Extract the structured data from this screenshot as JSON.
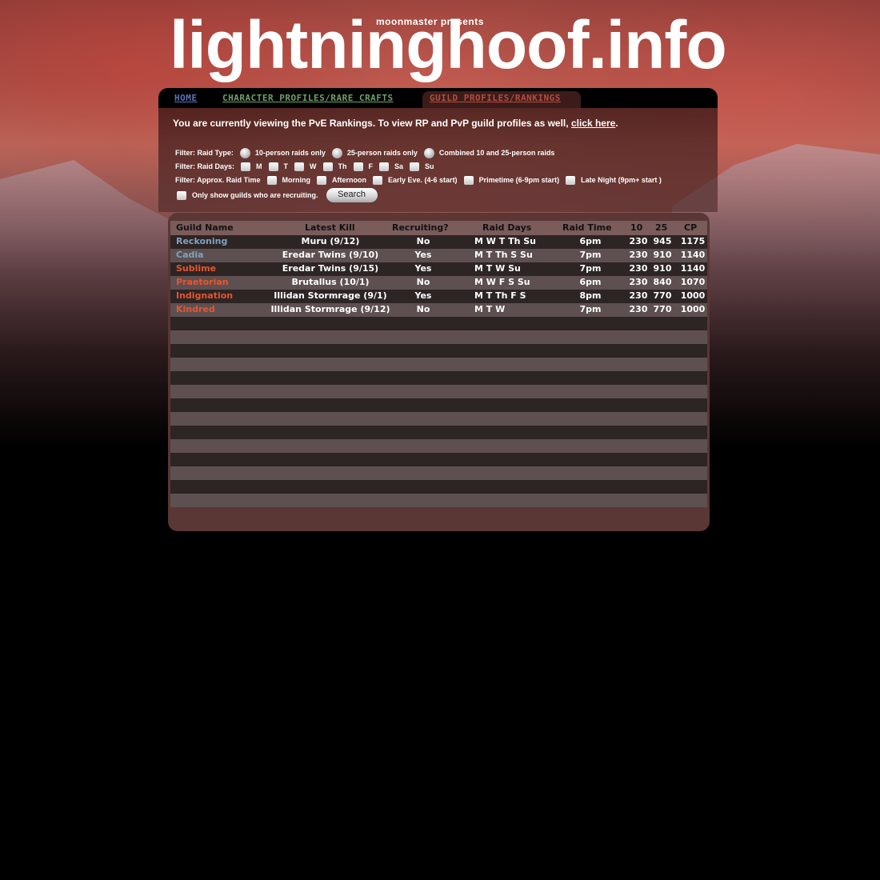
{
  "header": {
    "presents": "moonmaster presents",
    "title": "lightninghoof.info"
  },
  "nav": {
    "home": "HOME",
    "characters": "CHARACTER PROFILES/RARE CRAFTS",
    "guilds": "GUILD PROFILES/RANKINGS"
  },
  "notice": {
    "text": "You are currently viewing the PvE Rankings. To view RP and PvP guild profiles as well,",
    "link": "click here",
    "end": "."
  },
  "filters": {
    "raid_type_label": "Filter: Raid Type:",
    "raid_type_options": [
      "10-person raids only",
      "25-person raids only",
      "Combined 10 and 25-person raids"
    ],
    "raid_days_label": "Filter: Raid Days:",
    "raid_days_options": [
      "M",
      "T",
      "W",
      "Th",
      "F",
      "Sa",
      "Su"
    ],
    "raid_time_label": "Filter: Approx. Raid Time",
    "raid_time_options": [
      "Morning",
      "Afternoon",
      "Early Eve. (4-6 start)",
      "Primetime (6-9pm start)",
      "Late Night (9pm+ start )"
    ],
    "recruiting_label": "Only show guilds who are recruiting.",
    "search_label": "Search"
  },
  "table": {
    "headers": [
      "Guild Name",
      "Latest Kill",
      "Recruiting?",
      "Raid Days",
      "Raid Time",
      "10",
      "25",
      "CP"
    ],
    "rows": [
      {
        "name": "Reckoning",
        "color": "#7ea3bf",
        "kill": "Muru (9/12)",
        "recruiting": "No",
        "days": "M W T Th Su",
        "time": "6pm",
        "p10": "230",
        "p25": "945",
        "cp": "1175"
      },
      {
        "name": "Cadia",
        "color": "#7ea3bf",
        "kill": "Eredar Twins (9/10)",
        "recruiting": "Yes",
        "days": "M T Th S Su",
        "time": "7pm",
        "p10": "230",
        "p25": "910",
        "cp": "1140"
      },
      {
        "name": "Sublime",
        "color": "#e8552e",
        "kill": "Eredar Twins (9/15)",
        "recruiting": "Yes",
        "days": "M T W Su",
        "time": "7pm",
        "p10": "230",
        "p25": "910",
        "cp": "1140"
      },
      {
        "name": "Praetorian",
        "color": "#e8552e",
        "kill": "Brutallus (10/1)",
        "recruiting": "No",
        "days": "M W F S Su",
        "time": "6pm",
        "p10": "230",
        "p25": "840",
        "cp": "1070"
      },
      {
        "name": "Indignation",
        "color": "#e8552e",
        "kill": "Illidan Stormrage (9/1)",
        "recruiting": "Yes",
        "days": "M T Th F S",
        "time": "8pm",
        "p10": "230",
        "p25": "770",
        "cp": "1000"
      },
      {
        "name": "Kindred",
        "color": "#e8552e",
        "kill": "Illidan Stormrage (9/12)",
        "recruiting": "No",
        "days": "M T W",
        "time": "7pm",
        "p10": "230",
        "p25": "770",
        "cp": "1000"
      }
    ]
  }
}
